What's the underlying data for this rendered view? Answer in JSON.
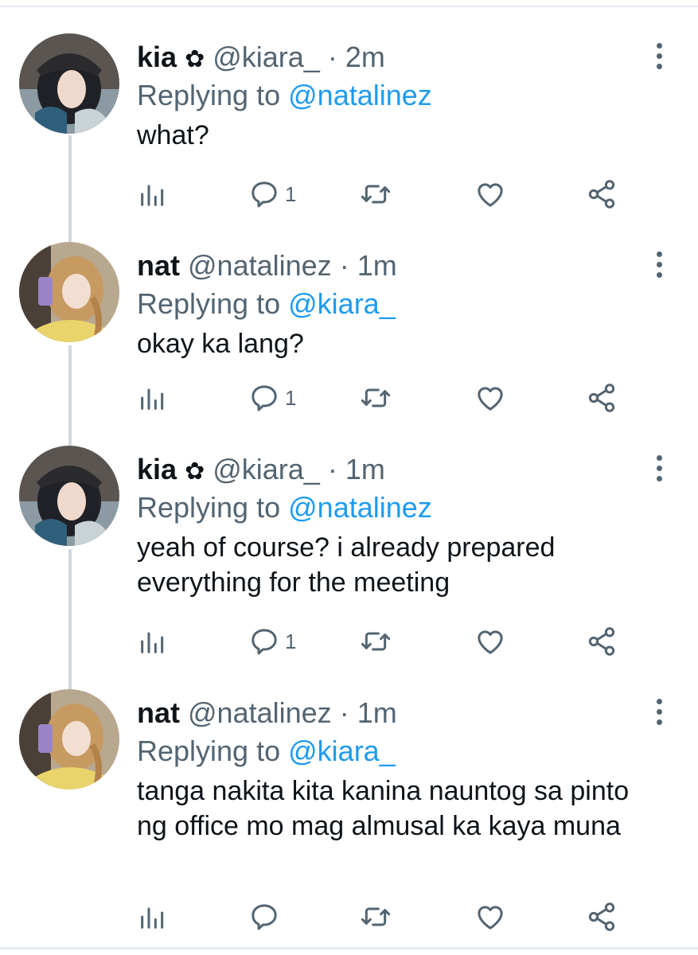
{
  "tweets": [
    {
      "name": "kia",
      "badge": "✿",
      "handle": "@kiara_",
      "time": "2m",
      "replying_label": "Replying to",
      "replying_to": "@natalinez",
      "text": "what?",
      "reply_count": "1",
      "avatar": "avatar-kia"
    },
    {
      "name": "nat",
      "badge": "",
      "handle": "@natalinez",
      "time": "1m",
      "replying_label": "Replying to",
      "replying_to": "@kiara_",
      "text": "okay ka lang?",
      "reply_count": "1",
      "avatar": "avatar-nat"
    },
    {
      "name": "kia",
      "badge": "✿",
      "handle": "@kiara_",
      "time": "1m",
      "replying_label": "Replying to",
      "replying_to": "@natalinez",
      "text": "yeah of course? i already prepared everything for the meeting",
      "reply_count": "1",
      "avatar": "avatar-kia"
    },
    {
      "name": "nat",
      "badge": "",
      "handle": "@natalinez",
      "time": "1m",
      "replying_label": "Replying to",
      "replying_to": "@kiara_",
      "text": "tanga nakita kita kanina nauntog sa pinto ng office mo mag almusal ka kaya muna",
      "reply_count": "",
      "avatar": "avatar-nat"
    }
  ],
  "separator": "·",
  "colors": {
    "text": "#0f1419",
    "muted": "#536471",
    "link": "#1d9bf0",
    "thread": "#cfd9de"
  },
  "icons": [
    "analytics-icon",
    "reply-icon",
    "retweet-icon",
    "like-icon",
    "share-icon",
    "more-icon"
  ]
}
